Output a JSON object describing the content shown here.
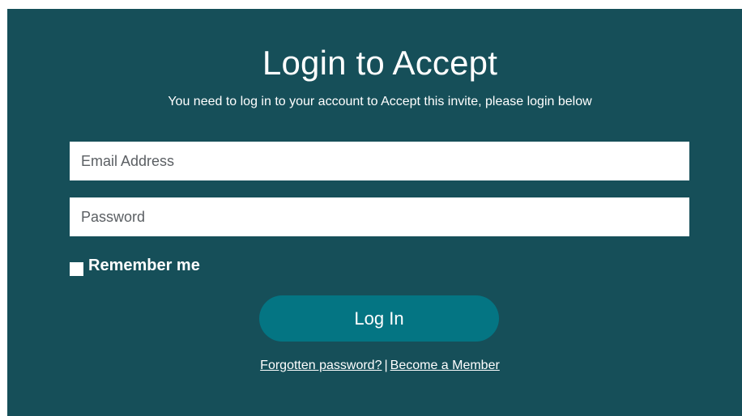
{
  "login": {
    "title": "Login to Accept",
    "subtitle": "You need to log in to your account to Accept this invite, please login below",
    "email_placeholder": "Email Address",
    "password_placeholder": "Password",
    "remember_label": "Remember me",
    "login_button": "Log In",
    "forgot_link": "Forgotten password?",
    "separator": "|",
    "member_link": "Become a Member"
  },
  "colors": {
    "panel_bg": "#164f59",
    "button_bg": "#047583",
    "text": "#ffffff"
  }
}
